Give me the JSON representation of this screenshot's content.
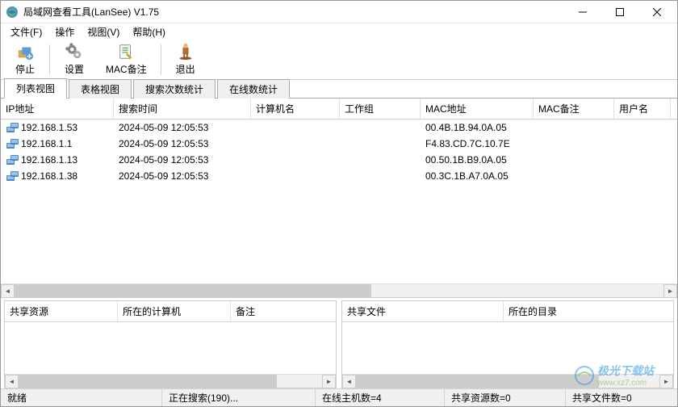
{
  "window": {
    "title": "局域网查看工具(LanSee) V1.75"
  },
  "menu": {
    "file": "文件(F)",
    "operate": "操作",
    "view": "视图(V)",
    "help": "帮助(H)"
  },
  "toolbar": {
    "stop": "停止",
    "settings": "设置",
    "mac_remark": "MAC备注",
    "exit": "退出"
  },
  "tabs": {
    "list_view": "列表视图",
    "table_view": "表格视图",
    "search_count": "搜索次数统计",
    "online_count": "在线数统计"
  },
  "columns": {
    "ip": "IP地址",
    "search_time": "搜索时间",
    "computer_name": "计算机名",
    "workgroup": "工作组",
    "mac": "MAC地址",
    "mac_remark": "MAC备注",
    "username": "用户名"
  },
  "rows": [
    {
      "ip": "192.168.1.53",
      "time": "2024-05-09 12:05:53",
      "cn": "",
      "wg": "",
      "mac": "00.4B.1B.94.0A.05",
      "mr": "",
      "un": ""
    },
    {
      "ip": "192.168.1.1",
      "time": "2024-05-09 12:05:53",
      "cn": "",
      "wg": "",
      "mac": "F4.83.CD.7C.10.7E",
      "mr": "",
      "un": ""
    },
    {
      "ip": "192.168.1.13",
      "time": "2024-05-09 12:05:53",
      "cn": "",
      "wg": "",
      "mac": "00.50.1B.B9.0A.05",
      "mr": "",
      "un": ""
    },
    {
      "ip": "192.168.1.38",
      "time": "2024-05-09 12:05:53",
      "cn": "",
      "wg": "",
      "mac": "00.3C.1B.A7.0A.05",
      "mr": "",
      "un": ""
    }
  ],
  "panel_left": {
    "h0": "共享资源",
    "h1": "所在的计算机",
    "h2": "备注"
  },
  "panel_right": {
    "h0": "共享文件",
    "h1": "所在的目录"
  },
  "status": {
    "ready": "就绪",
    "searching": "正在搜索(190)...",
    "online_hosts": "在线主机数=4",
    "share_res": "共享资源数=0",
    "share_files": "共享文件数=0"
  },
  "watermark": {
    "line1": "极光下载站",
    "line2": "www.xz7.com"
  }
}
